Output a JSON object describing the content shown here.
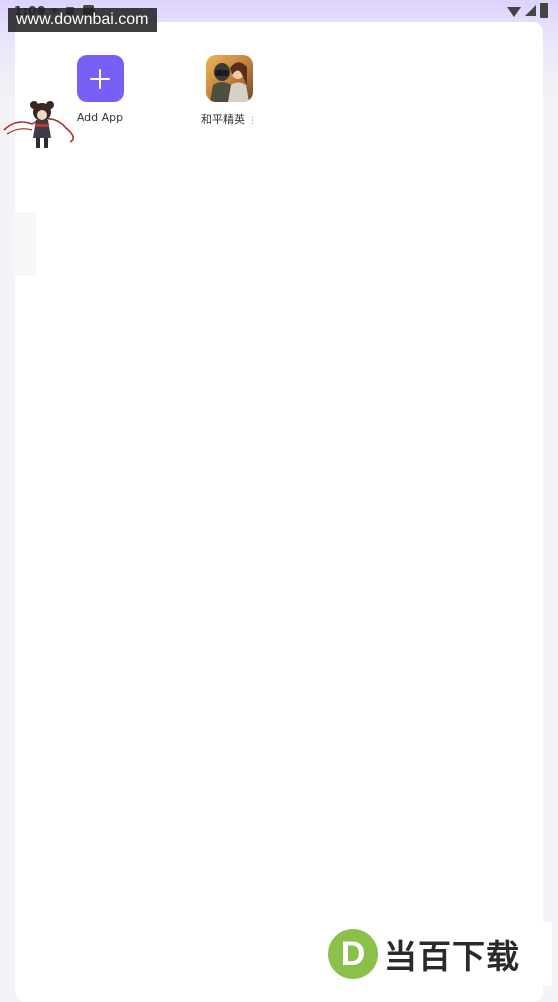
{
  "status_bar": {
    "time": "1:00",
    "icons": [
      "notification-dot-icon",
      "notification-dot-icon",
      "app-square-icon",
      "app-square-icon"
    ],
    "right_icons": [
      "wifi-icon",
      "signal-icon",
      "battery-icon"
    ]
  },
  "watermark_top": {
    "text": "www.downbai.com"
  },
  "apps": [
    {
      "label": "Add App",
      "icon": "plus-icon",
      "color": "#7760f5"
    },
    {
      "label": "和平精英",
      "icon": "game-icon",
      "menu_glyph": "⋮"
    }
  ],
  "logo_watermark": {
    "letter": "D",
    "text": "当百下载",
    "color": "#8bc14a"
  },
  "colors": {
    "accent": "#7760f5",
    "background": "#f3f2f6",
    "card": "#ffffff"
  }
}
